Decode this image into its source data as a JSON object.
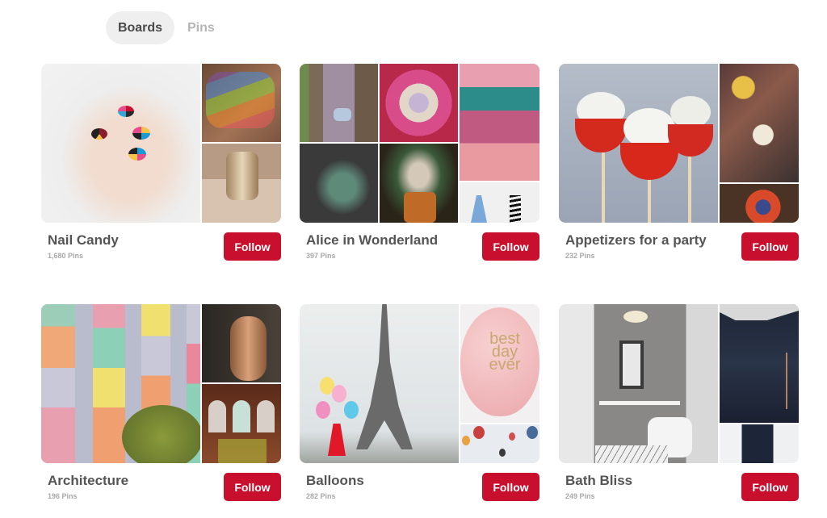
{
  "tabs": [
    {
      "label": "Boards",
      "active": true
    },
    {
      "label": "Pins",
      "active": false
    }
  ],
  "follow_label": "Follow",
  "accent_color": "#c8102e",
  "boards": [
    {
      "title": "Nail Candy",
      "pins": "1,680 Pins",
      "images": [
        "hand with geometric colorful nail art",
        "rainbow streak nails",
        "metallic gold nails with ring"
      ]
    },
    {
      "title": "Alice in Wonderland",
      "pins": "397 Pins",
      "images": [
        "tree door with white rabbit painting",
        "stacked teacups with Cheshire cat",
        "Alice in Wonderland party ideas",
        "girl in top hat sitting",
        "Mad Hatter makeup portrait",
        "Style: blue dress and striped stockings"
      ]
    },
    {
      "title": "Appetizers for a party",
      "pins": "232 Pins",
      "images": [
        "tomato mozzarella skewers",
        "charcuterie grazing board",
        "fruit tart"
      ]
    },
    {
      "title": "Architecture",
      "pins": "196 Pins",
      "images": [
        "colorful pastel balconies building",
        "bronze hand door knocker",
        "ornate arched windows room"
      ]
    },
    {
      "title": "Balloons",
      "pins": "282 Pins",
      "images": [
        "girl with balloons at Eiffel Tower",
        "pink balloon: best day ever",
        "hot air balloons in sky"
      ]
    },
    {
      "title": "Bath Bliss",
      "pins": "249 Pins",
      "images": [
        "silver mosaic powder room",
        "dark blue shower with brass fixtures",
        "navy door white tiled bathroom"
      ]
    }
  ]
}
